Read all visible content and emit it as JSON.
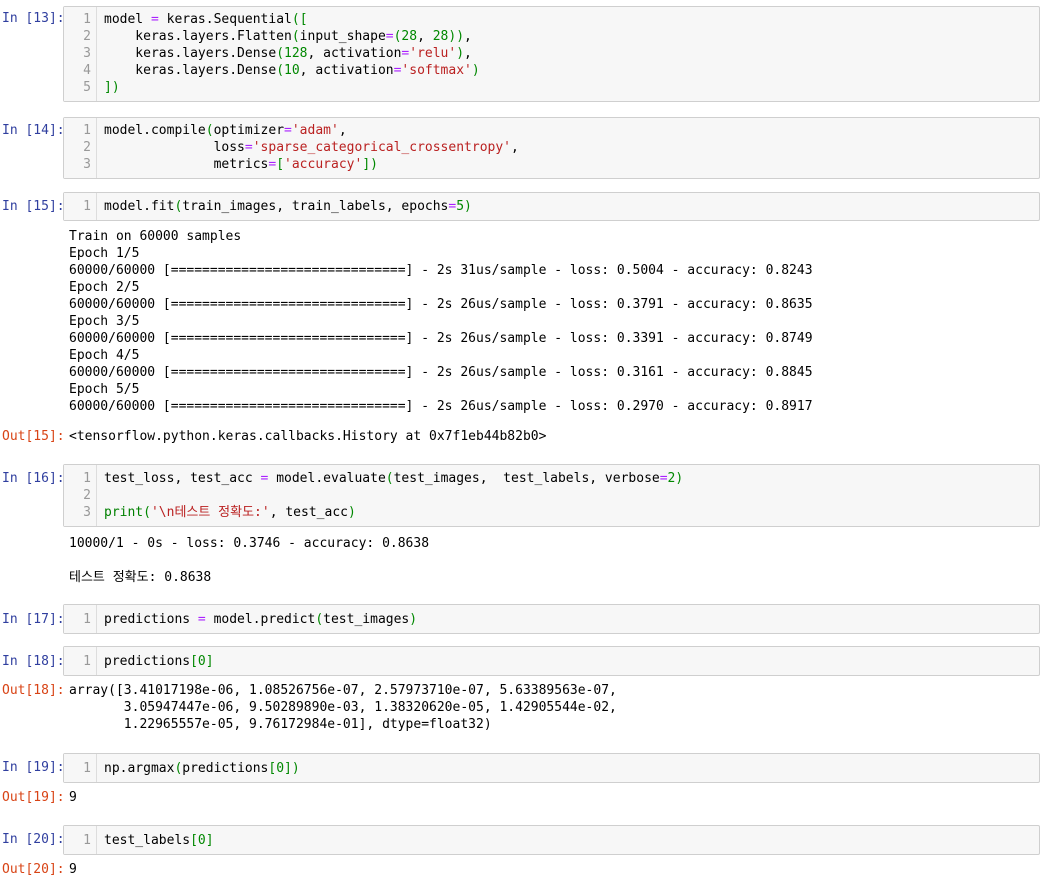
{
  "cells": [
    {
      "prompt": "In [13]:",
      "lines": [
        "model = keras.Sequential([",
        "    keras.layers.Flatten(input_shape=(28, 28)),",
        "    keras.layers.Dense(128, activation='relu'),",
        "    keras.layers.Dense(10, activation='softmax')",
        "])"
      ]
    },
    {
      "prompt": "In [14]:",
      "lines": [
        "model.compile(optimizer='adam',",
        "              loss='sparse_categorical_crossentropy',",
        "              metrics=['accuracy'])"
      ]
    },
    {
      "prompt": "In [15]:",
      "lines": [
        "model.fit(train_images, train_labels, epochs=5)"
      ],
      "stream": [
        "Train on 60000 samples",
        "Epoch 1/5",
        "60000/60000 [==============================] - 2s 31us/sample - loss: 0.5004 - accuracy: 0.8243",
        "Epoch 2/5",
        "60000/60000 [==============================] - 2s 26us/sample - loss: 0.3791 - accuracy: 0.8635",
        "Epoch 3/5",
        "60000/60000 [==============================] - 2s 26us/sample - loss: 0.3391 - accuracy: 0.8749",
        "Epoch 4/5",
        "60000/60000 [==============================] - 2s 26us/sample - loss: 0.3161 - accuracy: 0.8845",
        "Epoch 5/5",
        "60000/60000 [==============================] - 2s 26us/sample - loss: 0.2970 - accuracy: 0.8917"
      ],
      "out_prompt": "Out[15]:",
      "out": "<tensorflow.python.keras.callbacks.History at 0x7f1eb44b82b0>"
    },
    {
      "prompt": "In [16]:",
      "lines": [
        "test_loss, test_acc = model.evaluate(test_images,  test_labels, verbose=2)",
        "",
        "print('\\n테스트 정확도:', test_acc)"
      ],
      "stream": [
        "10000/1 - 0s - loss: 0.3746 - accuracy: 0.8638",
        "",
        "테스트 정확도: 0.8638"
      ]
    },
    {
      "prompt": "In [17]:",
      "lines": [
        "predictions = model.predict(test_images)"
      ]
    },
    {
      "prompt": "In [18]:",
      "lines": [
        "predictions[0]"
      ],
      "out_prompt": "Out[18]:",
      "out_lines": [
        "array([3.41017198e-06, 1.08526756e-07, 2.57973710e-07, 5.63389563e-07,",
        "       3.05947447e-06, 9.50289890e-03, 1.38320620e-05, 1.42905544e-02,",
        "       1.22965557e-05, 9.76172984e-01], dtype=float32)"
      ]
    },
    {
      "prompt": "In [19]:",
      "lines": [
        "np.argmax(predictions[0])"
      ],
      "out_prompt": "Out[19]:",
      "out": "9"
    },
    {
      "prompt": "In [20]:",
      "lines": [
        "test_labels[0]"
      ],
      "out_prompt": "Out[20]:",
      "out": "9"
    }
  ]
}
